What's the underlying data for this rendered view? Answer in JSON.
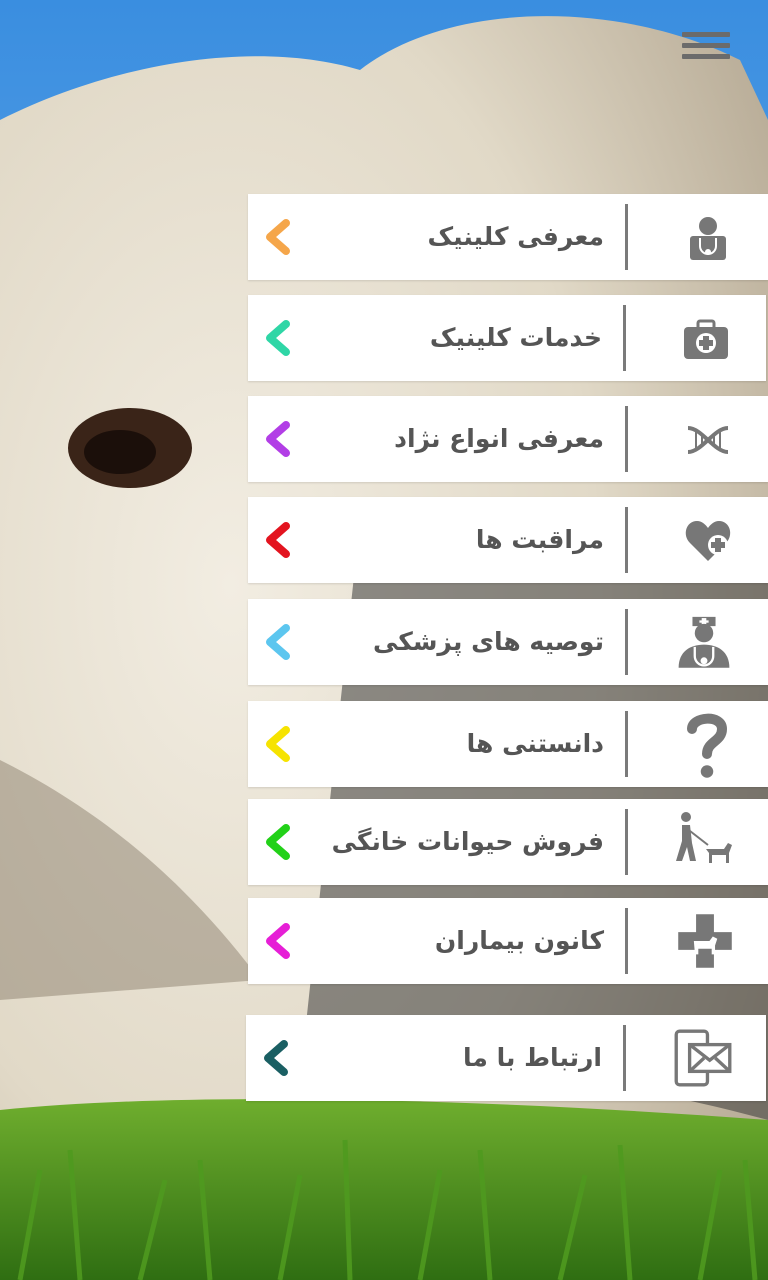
{
  "menu_button": {
    "icon": "hamburger-menu-icon"
  },
  "menu": {
    "items": [
      {
        "label": "معرفی کلینیک",
        "icon": "doctor-bag-user-icon",
        "color": "#f5a64a"
      },
      {
        "label": "خدمات کلینیک",
        "icon": "first-aid-kit-icon",
        "color": "#2fd6a6"
      },
      {
        "label": "معرفی انواع نژاد",
        "icon": "dna-icon",
        "color": "#b23ee6"
      },
      {
        "label": "مراقبت ها",
        "icon": "heart-plus-icon",
        "color": "#e3141f"
      },
      {
        "label": "توصیه های پزشکی",
        "icon": "doctor-icon",
        "color": "#5cc6ef"
      },
      {
        "label": "دانستنی ها",
        "icon": "question-mark-icon",
        "color": "#f6e300"
      },
      {
        "label": "فروش حیوانات خانگی",
        "icon": "dog-walker-icon",
        "color": "#22d118"
      },
      {
        "label": "کانون بیماران",
        "icon": "pet-cross-icon",
        "color": "#e61fd6"
      },
      {
        "label": "ارتباط با ما",
        "icon": "mobile-mail-icon",
        "color": "#1a5f63"
      }
    ]
  }
}
